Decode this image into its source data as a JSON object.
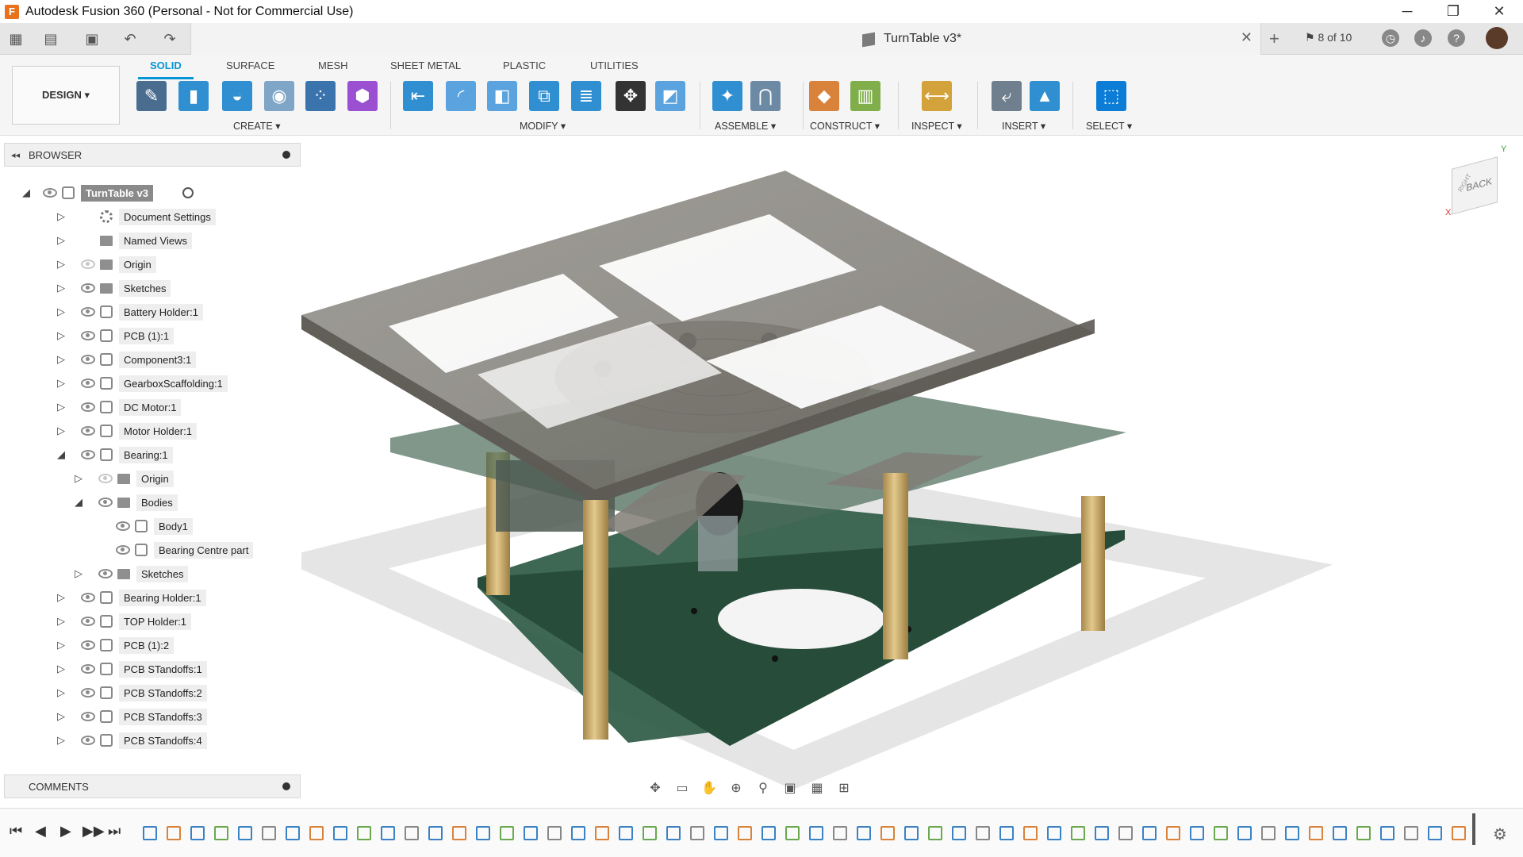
{
  "window": {
    "title": "Autodesk Fusion 360 (Personal - Not for Commercial Use)",
    "minimize": "─",
    "restore": "❐",
    "close": "✕"
  },
  "document": {
    "tab_name": "TurnTable v3*",
    "close": "✕",
    "new_tab": "+",
    "jobs": "8 of 10"
  },
  "quick_access": {
    "grid": "▦",
    "file": "▤",
    "save": "▣",
    "undo": "↶",
    "redo": "↷"
  },
  "ribbon": {
    "workspace": "DESIGN ▾",
    "tabs": [
      "SOLID",
      "SURFACE",
      "MESH",
      "SHEET METAL",
      "PLASTIC",
      "UTILITIES"
    ],
    "groups": [
      "CREATE ▾",
      "MODIFY ▾",
      "ASSEMBLE ▾",
      "CONSTRUCT ▾",
      "INSPECT ▾",
      "INSERT ▾",
      "SELECT ▾"
    ],
    "tools": [
      {
        "name": "create-sketch",
        "icon": "✎",
        "color": "#4a6d8f"
      },
      {
        "name": "extrude",
        "icon": "▮",
        "color": "#2f8fd0"
      },
      {
        "name": "revolve",
        "icon": "◒",
        "color": "#2f8fd0"
      },
      {
        "name": "hole",
        "icon": "◉",
        "color": "#7fa6c7"
      },
      {
        "name": "pattern",
        "icon": "⁘",
        "color": "#3b74ad"
      },
      {
        "name": "form",
        "icon": "⬢",
        "color": "#9b4fd1"
      },
      {
        "name": "press-pull",
        "icon": "⇤",
        "color": "#2f8fd0"
      },
      {
        "name": "fillet",
        "icon": "◜",
        "color": "#5aa3df"
      },
      {
        "name": "shell",
        "icon": "◧",
        "color": "#5aa3df"
      },
      {
        "name": "combine",
        "icon": "⧉",
        "color": "#2f8fd0"
      },
      {
        "name": "scale",
        "icon": "≣",
        "color": "#2f8fd0"
      },
      {
        "name": "move",
        "icon": "✥",
        "color": "#333"
      },
      {
        "name": "split",
        "icon": "◩",
        "color": "#5aa3df"
      },
      {
        "name": "new-component",
        "icon": "✦",
        "color": "#2f8fd0"
      },
      {
        "name": "joint",
        "icon": "⋂",
        "color": "#6c8aa3"
      },
      {
        "name": "offset-plane",
        "icon": "◆",
        "color": "#d9823b"
      },
      {
        "name": "midplane",
        "icon": "▥",
        "color": "#7fae4a"
      },
      {
        "name": "measure",
        "icon": "⟷",
        "color": "#d4a23a"
      },
      {
        "name": "insert-derive",
        "icon": "⤶",
        "color": "#6f7f8e"
      },
      {
        "name": "insert-image",
        "icon": "▲",
        "color": "#2f8fd0"
      },
      {
        "name": "select",
        "icon": "⬚",
        "color": "#0b7dd6"
      }
    ]
  },
  "browser": {
    "title": "BROWSER",
    "collapse": "◂◂",
    "items": [
      {
        "label": "TurnTable v3",
        "depth": 0,
        "toggle": "◢",
        "icon": "doc",
        "visible": true,
        "root": true
      },
      {
        "label": "Document Settings",
        "depth": 1,
        "toggle": "▷",
        "icon": "gear",
        "visible": null
      },
      {
        "label": "Named Views",
        "depth": 1,
        "toggle": "▷",
        "icon": "folder",
        "visible": null
      },
      {
        "label": "Origin",
        "depth": 1,
        "toggle": "▷",
        "icon": "folder",
        "visible": false
      },
      {
        "label": "Sketches",
        "depth": 1,
        "toggle": "▷",
        "icon": "folder",
        "visible": true
      },
      {
        "label": "Battery Holder:1",
        "depth": 1,
        "toggle": "▷",
        "icon": "comp",
        "visible": true
      },
      {
        "label": "PCB (1):1",
        "depth": 1,
        "toggle": "▷",
        "icon": "comp",
        "visible": true
      },
      {
        "label": "Component3:1",
        "depth": 1,
        "toggle": "▷",
        "icon": "comp",
        "visible": true
      },
      {
        "label": "GearboxScaffolding:1",
        "depth": 1,
        "toggle": "▷",
        "icon": "comp",
        "visible": true
      },
      {
        "label": "DC Motor:1",
        "depth": 1,
        "toggle": "▷",
        "icon": "comp",
        "visible": true
      },
      {
        "label": "Motor Holder:1",
        "depth": 1,
        "toggle": "▷",
        "icon": "comp",
        "visible": true
      },
      {
        "label": "Bearing:1",
        "depth": 1,
        "toggle": "◢",
        "icon": "comp",
        "visible": true
      },
      {
        "label": "Origin",
        "depth": 2,
        "toggle": "▷",
        "icon": "folder",
        "visible": false
      },
      {
        "label": "Bodies",
        "depth": 2,
        "toggle": "◢",
        "icon": "folder",
        "visible": true
      },
      {
        "label": "Body1",
        "depth": 3,
        "toggle": "",
        "icon": "comp",
        "visible": true
      },
      {
        "label": "Bearing Centre part",
        "depth": 3,
        "toggle": "",
        "icon": "comp",
        "visible": true
      },
      {
        "label": "Sketches",
        "depth": 2,
        "toggle": "▷",
        "icon": "folder",
        "visible": true
      },
      {
        "label": "Bearing Holder:1",
        "depth": 1,
        "toggle": "▷",
        "icon": "comp",
        "visible": true
      },
      {
        "label": "TOP Holder:1",
        "depth": 1,
        "toggle": "▷",
        "icon": "comp",
        "visible": true
      },
      {
        "label": "PCB (1):2",
        "depth": 1,
        "toggle": "▷",
        "icon": "comp",
        "visible": true
      },
      {
        "label": "PCB STandoffs:1",
        "depth": 1,
        "toggle": "▷",
        "icon": "comp",
        "visible": true
      },
      {
        "label": "PCB STandoffs:2",
        "depth": 1,
        "toggle": "▷",
        "icon": "comp",
        "visible": true
      },
      {
        "label": "PCB STandoffs:3",
        "depth": 1,
        "toggle": "▷",
        "icon": "comp",
        "visible": true
      },
      {
        "label": "PCB STandoffs:4",
        "depth": 1,
        "toggle": "▷",
        "icon": "comp",
        "visible": true
      }
    ]
  },
  "comments": {
    "title": "COMMENTS"
  },
  "viewcube": {
    "face": "BACK",
    "side": "RIGHT",
    "x": "X",
    "y": "Y"
  },
  "navbar": {
    "tools": [
      "✥",
      "▭",
      "✋",
      "⊕",
      "⚲",
      "▣",
      "▦",
      "⊞"
    ]
  },
  "timeline": {
    "controls": [
      "⏮",
      "◀",
      "▶",
      "▶▶",
      "⏭"
    ],
    "feature_count": 56,
    "settings": "⚙"
  },
  "colors": {
    "accent": "#0696d7",
    "pcb_green": "#2e5a45",
    "standoff": "#c9a961",
    "frame_gray": "#7d7a73"
  }
}
